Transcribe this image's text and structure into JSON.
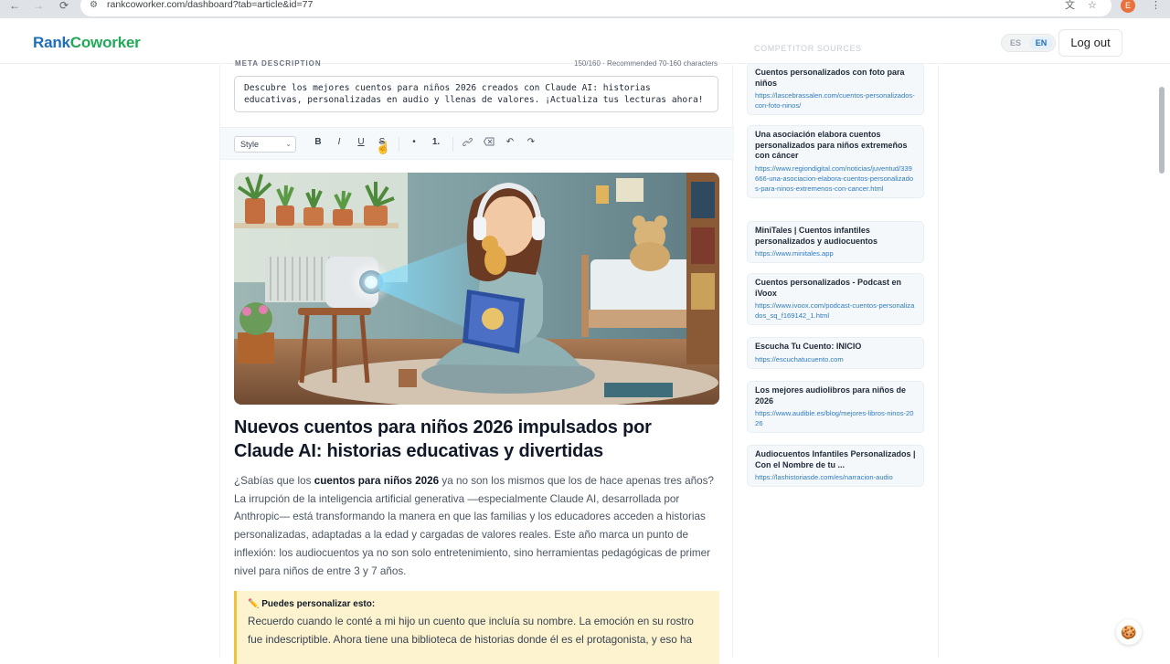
{
  "browser": {
    "url": "rankcoworker.com/dashboard?tab=article&id=77",
    "profile_initial": "E"
  },
  "header": {
    "logo_part1": "Rank",
    "logo_part2": "Coworker",
    "lang_es": "ES",
    "lang_en": "EN",
    "logout": "Log out"
  },
  "meta": {
    "label": "META DESCRIPTION",
    "count": "150/160 · Recommended 70-160 characters",
    "value": "Descubre los mejores cuentos para niños 2026 creados con Claude AI: historias educativas, personalizadas en audio y llenas de valores. ¡Actualiza tus lecturas ahora!"
  },
  "toolbar": {
    "style": "Style",
    "bold": "B",
    "italic": "I",
    "underline": "U",
    "strike": "S",
    "bullet": "•",
    "ordered": "1.",
    "undo": "↶",
    "redo": "↷"
  },
  "article": {
    "title": "Nuevos cuentos para niños 2026 impulsados por Claude AI: historias educativas y divertidas",
    "intro_before": "¿Sabías que los ",
    "intro_bold": "cuentos para niños 2026",
    "intro_after": " ya no son los mismos que los de hace apenas tres años? La irrupción de la inteligencia artificial generativa —especialmente Claude AI, desarrollada por Anthropic— está transformando la manera en que las familias y los educadores acceden a historias personalizadas, adaptadas a la edad y cargadas de valores reales. Este año marca un punto de inflexión: los audiocuentos ya no son solo entretenimiento, sino herramientas pedagógicas de primer nivel para niños de entre 3 y 7 años.",
    "callout_title": "Puedes personalizar esto:",
    "callout_text": "Recuerdo cuando le conté a mi hijo un cuento que incluía su nombre. La emoción en su rostro fue indescriptible. Ahora tiene una biblioteca de historias donde él es el protagonista, y eso ha"
  },
  "sidebar": {
    "heading": "COMPETITOR SOURCES",
    "sources": [
      {
        "title": "Cuentos personalizados con foto para niños",
        "url": "https://lascebrassalen.com/cuentos-personalizados-con-foto-ninos/"
      },
      {
        "title": "Una asociación elabora cuentos personalizados para niños extremeños con cáncer",
        "url": "https://www.regiondigital.com/noticias/juventud/339666-una-asociacion-elabora-cuentos-personalizados-para-ninos-extremenos-con-cancer.html"
      },
      {
        "title": "MiniTales | Cuentos infantiles personalizados y audiocuentos",
        "url": "https://www.minitales.app"
      },
      {
        "title": "Cuentos personalizados - Podcast en iVoox",
        "url": "https://www.ivoox.com/podcast-cuentos-personalizados_sq_f169142_1.html"
      },
      {
        "title": "Escucha Tu Cuento: INICIO",
        "url": "https://escuchatucuento.com"
      },
      {
        "title": "Los mejores audiolibros para niños de 2026",
        "url": "https://www.audible.es/blog/mejores-libros-ninos-2026"
      },
      {
        "title": "Audiocuentos Infantiles Personalizados | Con el Nombre de tu ...",
        "url": "https://lashistoriasde.com/es/narracion-audio"
      }
    ]
  }
}
